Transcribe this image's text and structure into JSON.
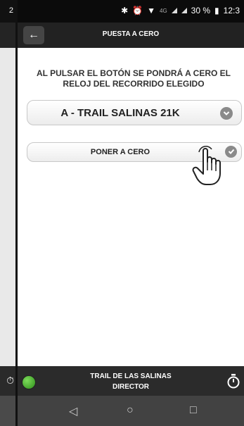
{
  "background_app": {
    "status_time_fragment": "2"
  },
  "status_bar": {
    "network": "4G",
    "battery_percent": "30 %",
    "time": "12:3"
  },
  "header": {
    "back_icon": "←",
    "title": "PUESTA A CERO"
  },
  "main": {
    "instruction_line1": "AL PULSAR EL BOTÓN SE PONDRÁ A CERO EL",
    "instruction_line2": "RELOJ DEL RECORRIDO ELEGIDO",
    "route_select": {
      "value": "A - TRAIL SALINAS 21K",
      "icon": "chevron-down-circle-icon"
    },
    "reset_button": {
      "label": "PONER A CERO",
      "icon": "check-circle-icon"
    }
  },
  "bottom_bar": {
    "line1": "TRAIL DE LAS SALINAS",
    "line2": "DIRECTOR",
    "status_color": "#3aa124"
  },
  "nav": {
    "back": "◁",
    "home": "○",
    "recents": "□"
  }
}
